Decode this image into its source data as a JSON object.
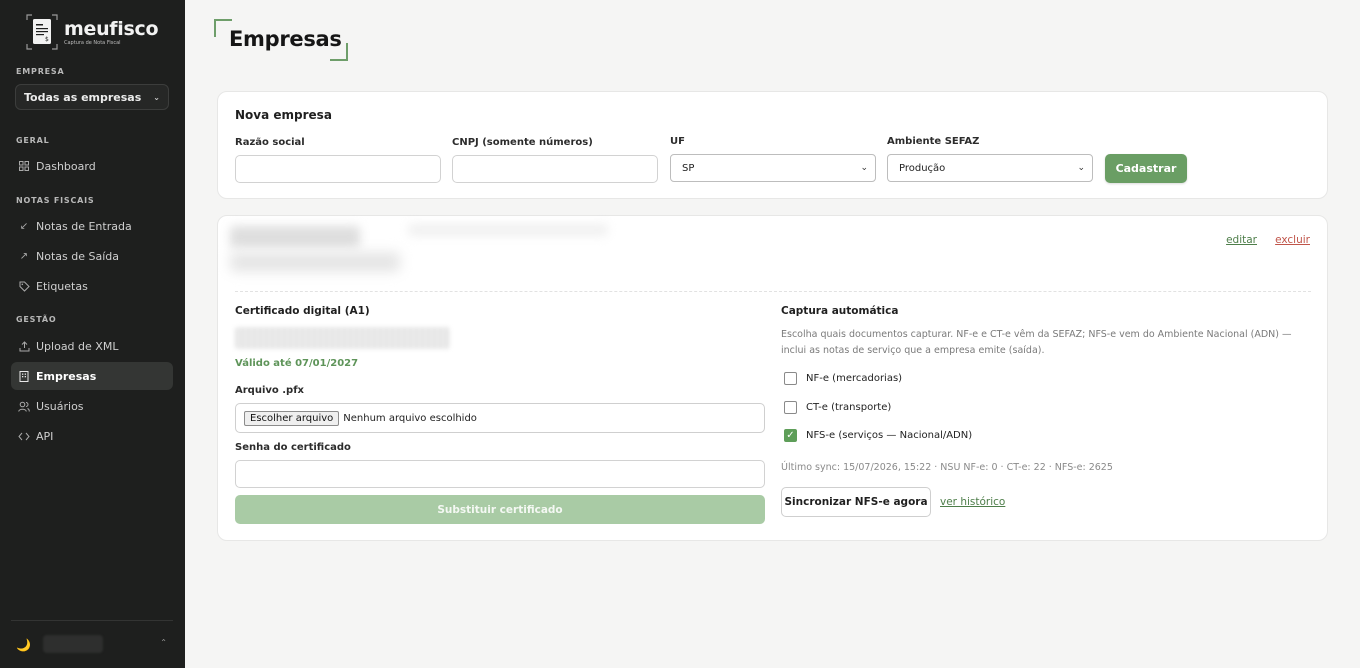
{
  "brand": {
    "name": "meufisco",
    "tagline": "Captura de Nota Fiscal",
    "accent": "#6a9e64"
  },
  "sidebar": {
    "company_section": "EMPRESA",
    "company_select": "Todas as empresas",
    "sections": {
      "geral": "GERAL",
      "notas": "NOTAS FISCAIS",
      "gestao": "GESTÃO"
    },
    "items": [
      {
        "label": "Dashboard",
        "icon": "grid-icon"
      },
      {
        "label": "Notas de Entrada",
        "icon": "arrow-down-left-icon"
      },
      {
        "label": "Notas de Saída",
        "icon": "arrow-up-right-icon"
      },
      {
        "label": "Etiquetas",
        "icon": "tag-icon"
      },
      {
        "label": "Upload de XML",
        "icon": "upload-icon"
      },
      {
        "label": "Empresas",
        "icon": "building-icon",
        "active": true
      },
      {
        "label": "Usuários",
        "icon": "users-icon"
      },
      {
        "label": "API",
        "icon": "code-icon"
      }
    ]
  },
  "page": {
    "title": "Empresas"
  },
  "new_company": {
    "title": "Nova empresa",
    "fields": {
      "razao_label": "Razão social",
      "cnpj_label": "CNPJ (somente números)",
      "uf_label": "UF",
      "uf_value": "SP",
      "ambiente_label": "Ambiente SEFAZ",
      "ambiente_value": "Produção"
    },
    "submit": "Cadastrar"
  },
  "company_card": {
    "edit": "editar",
    "delete": "excluir",
    "certificate": {
      "title": "Certificado digital (A1)",
      "valid": "Válido até 07/01/2027",
      "file_label": "Arquivo .pfx",
      "file_button": "Escolher arquivo",
      "file_none": "Nenhum arquivo escolhido",
      "password_label": "Senha do certificado",
      "replace_button": "Substituir certificado"
    },
    "capture": {
      "title": "Captura automática",
      "description": "Escolha quais documentos capturar. NF-e e CT-e vêm da SEFAZ; NFS-e vem do Ambiente Nacional (ADN) — inclui as notas de serviço que a empresa emite (saída).",
      "options": [
        {
          "label": "NF-e (mercadorias)",
          "checked": false
        },
        {
          "label": "CT-e (transporte)",
          "checked": false
        },
        {
          "label": "NFS-e (serviços — Nacional/ADN)",
          "checked": true
        }
      ],
      "last_sync": "Último sync: 15/07/2026, 15:22 · NSU NF-e: 0 · CT-e: 22 · NFS-e: 2625",
      "sync_button": "Sincronizar NFS-e agora",
      "history_link": "ver histórico"
    }
  }
}
